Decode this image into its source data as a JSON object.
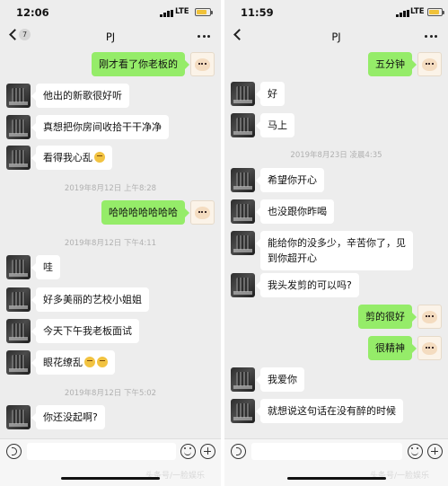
{
  "left": {
    "status": {
      "time": "12:06",
      "network": "LTE"
    },
    "nav": {
      "back_badge": "7",
      "title": "PJ",
      "more": "···"
    },
    "timestamps": [
      "2019年8月12日 上午8:28",
      "2019年8月12日 下午4:11",
      "2019年8月12日 下午5:02"
    ],
    "messages": [
      {
        "sender": "me",
        "text": "刚才看了你老板的"
      },
      {
        "sender": "pj",
        "text": "他出的新歌很好听"
      },
      {
        "sender": "pj",
        "text": "真想把你房间收拾干干净净"
      },
      {
        "sender": "pj",
        "text": "看得我心乱"
      },
      {
        "sender": "me",
        "text": "哈哈哈哈哈哈哈"
      },
      {
        "sender": "pj",
        "text": "哇"
      },
      {
        "sender": "pj",
        "text": "好多美丽的艺校小姐姐"
      },
      {
        "sender": "pj",
        "text": "今天下午我老板面试"
      },
      {
        "sender": "pj",
        "text": "眼花缭乱"
      },
      {
        "sender": "pj",
        "text": "你还没起啊?"
      }
    ],
    "watermark": "头条号/一脸娱乐"
  },
  "right": {
    "status": {
      "time": "11:59",
      "network": "LTE"
    },
    "nav": {
      "title": "PJ",
      "more": "···"
    },
    "timestamps": [
      "2019年8月23日 凌晨4:35"
    ],
    "messages": [
      {
        "sender": "me",
        "text": "五分钟"
      },
      {
        "sender": "pj",
        "text": "好"
      },
      {
        "sender": "pj",
        "text": "马上"
      },
      {
        "sender": "pj",
        "text": "希望你开心"
      },
      {
        "sender": "pj",
        "text": "也没跟你昨喝"
      },
      {
        "sender": "pj",
        "text": "能给你的没多少，辛苦你了，见到你超开心"
      },
      {
        "sender": "pj",
        "text": "我头发剪的可以吗?"
      },
      {
        "sender": "me",
        "text": "剪的很好"
      },
      {
        "sender": "me",
        "text": "很精神"
      },
      {
        "sender": "pj",
        "text": "我爱你"
      },
      {
        "sender": "pj",
        "text": "就想说这句话在没有醉的时候"
      }
    ],
    "watermark": "头条号/一脸娱乐"
  },
  "colors": {
    "chat_bg": "#ededed",
    "outgoing_bubble": "#95ec69",
    "incoming_bubble": "#ffffff",
    "battery": "#f0c23a"
  },
  "icons": [
    "back-icon",
    "more-icon",
    "voice-icon",
    "emoji-icon",
    "plus-icon",
    "avatar"
  ]
}
